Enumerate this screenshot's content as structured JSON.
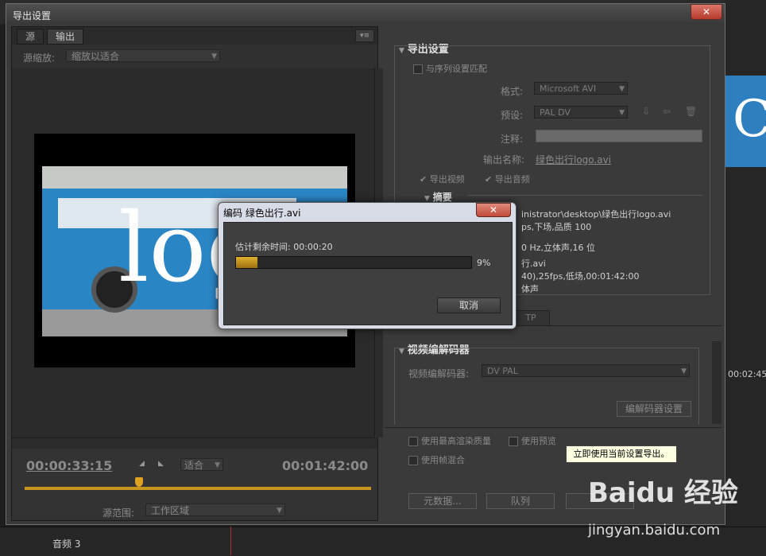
{
  "background_app": {
    "track_label": "音频 3",
    "timecode": "00:02:45"
  },
  "window": {
    "title": "导出设置",
    "close_label": "✕"
  },
  "source_panel": {
    "tabs": [
      "源",
      "输出"
    ],
    "scale_label": "源缩放:",
    "scale_value": "缩放以适合",
    "video_text": "logo",
    "current_timecode": "00:00:33:15",
    "total_timecode": "00:01:42:00",
    "fit_value": "适合",
    "range_label": "源范围:",
    "range_value": "工作区域",
    "playhead_progress": 0.33
  },
  "export_settings": {
    "section_title": "导出设置",
    "match_sequence": "与序列设置匹配",
    "format_label": "格式:",
    "format_value": "Microsoft AVI",
    "preset_label": "预设:",
    "preset_value": "PAL DV",
    "comment_label": "注释:",
    "output_name_label": "输出名称:",
    "output_name_value": "绿色出行logo.avi",
    "export_video": "导出视频",
    "export_audio": "导出音频",
    "summary_title": "摘要",
    "summary_lines": [
      "inistrator\\desktop\\绿色出行logo.avi",
      "ps,下场,品质 100",
      "0 Hz,立体声,16 位",
      "行.avi",
      "40),25fps,低场,00:01:42:00",
      "体声"
    ],
    "tab_fragment": "TP"
  },
  "video_codec": {
    "section_title": "视频编解码器",
    "codec_label": "视频编解码器:",
    "codec_value": "DV PAL",
    "codec_settings_button": "编解码器设置"
  },
  "bottom_options": {
    "max_render_quality": "使用最高渲染质量",
    "use_previews": "使用预览",
    "frame_blending": "使用帧混合",
    "metadata_button": "元数据...",
    "queue_button": "队列"
  },
  "tooltip": "立即使用当前设置导出。",
  "encode_dialog": {
    "title": "编码 绿色出行.avi",
    "close_label": "✕",
    "eta": "估计剩余时间: 00:00:20",
    "progress_percent": 9,
    "progress_label": "9%",
    "cancel_button": "取消"
  },
  "watermark": {
    "brand": "Baidu 经验",
    "url": "jingyan.baidu.com"
  },
  "colors": {
    "progress_fill": "#c8961e",
    "bus_blue": "#2a85c4",
    "close_red": "#c24a3a"
  }
}
